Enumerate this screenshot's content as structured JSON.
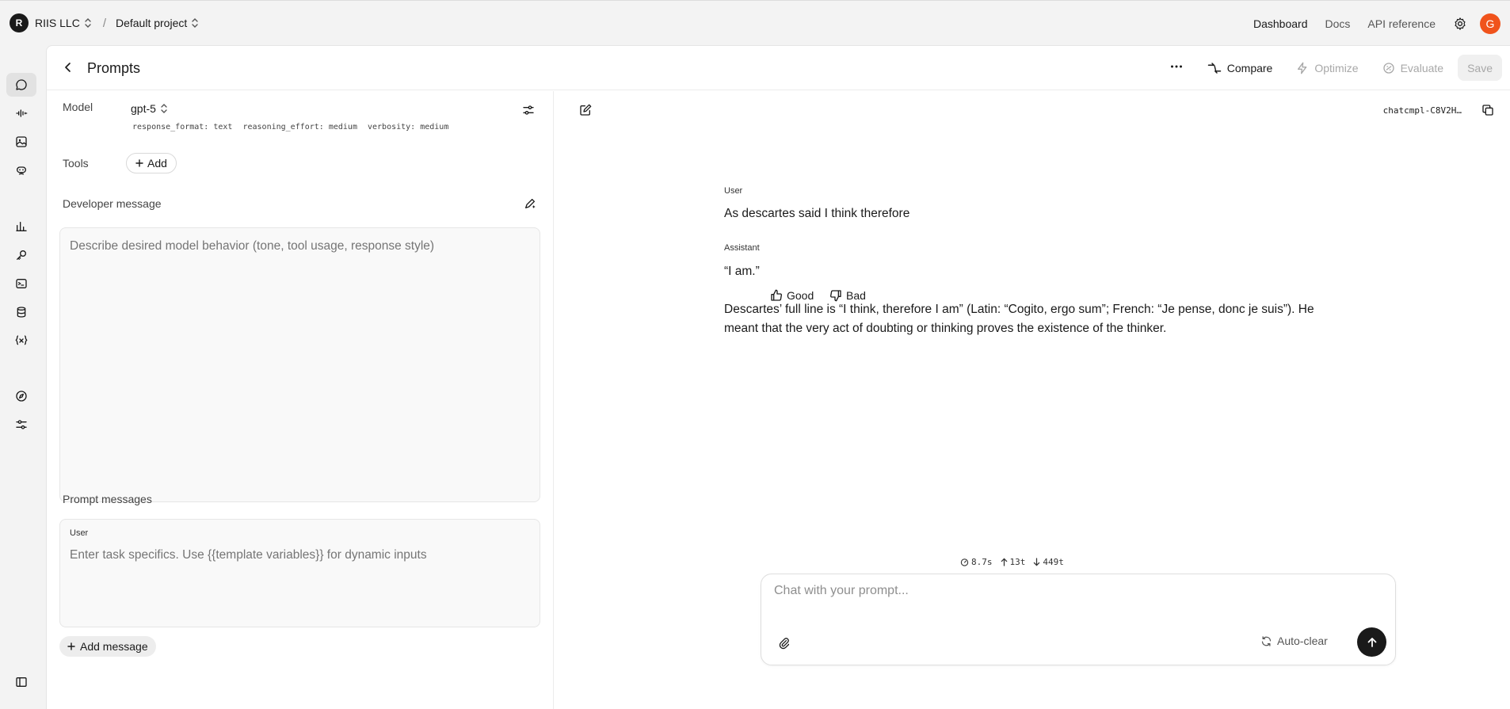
{
  "topbar": {
    "org_initial": "R",
    "org_name": "RIIS LLC",
    "separator": "/",
    "project_name": "Default project",
    "links": {
      "dashboard": "Dashboard",
      "docs": "Docs",
      "api_reference": "API reference"
    },
    "user_initial": "G",
    "user_avatar_color": "#f0531c"
  },
  "rail": {
    "icons": [
      "chat-icon",
      "audio-icon",
      "image-icon",
      "assistant-icon",
      "usage-icon",
      "key-icon",
      "terminal-icon",
      "storage-icon",
      "variables-icon",
      "explore-icon",
      "settings-sliders-icon",
      "sidebar-toggle-icon"
    ]
  },
  "header": {
    "title": "Prompts",
    "compare": "Compare",
    "optimize": "Optimize",
    "evaluate": "Evaluate",
    "save": "Save"
  },
  "config": {
    "model_label": "Model",
    "model_value": "gpt-5",
    "params": [
      "response_format: text",
      "reasoning_effort: medium",
      "verbosity: medium"
    ],
    "tools_label": "Tools",
    "tools_add": "Add",
    "developer_label": "Developer message",
    "developer_placeholder": "Describe desired model behavior (tone, tool usage, response style)",
    "prompt_messages_label": "Prompt messages",
    "prompt_role": "User",
    "prompt_placeholder": "Enter task specifics. Use {{template variables}} for dynamic inputs",
    "add_message": "Add message"
  },
  "chat": {
    "completion_id": "chatcmpl-C8V2H…",
    "user_role": "User",
    "user_message": "As descartes said I think therefore",
    "assistant_role": "Assistant",
    "assistant_line1": "“I am.”",
    "assistant_line2": "Descartes’ full line is “I think, therefore I am” (Latin: “Cogito, ergo sum”; French: “Je pense, donc je suis”). He meant that the very act of doubting or thinking proves the existence of the thinker.",
    "good": "Good",
    "bad": "Bad",
    "stats": {
      "time": "8.7s",
      "input_tokens": "13t",
      "output_tokens": "449t"
    },
    "composer_placeholder": "Chat with your prompt...",
    "auto_clear": "Auto-clear"
  }
}
